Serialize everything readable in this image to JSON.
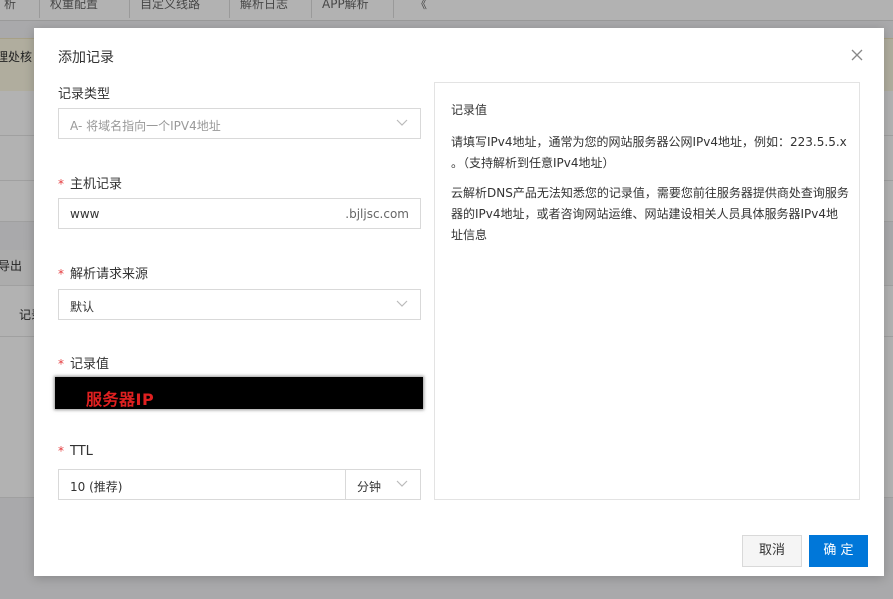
{
  "background": {
    "tabs": [
      "析",
      "权重配置",
      "自定义线路",
      "解析日志",
      "APP解析",
      "《"
    ],
    "banner_text": "理处核",
    "side_texts": [
      "导出",
      "记录"
    ]
  },
  "dialog": {
    "title": "添加记录",
    "close_icon": "close-icon",
    "fields": {
      "record_type": {
        "label": "记录类型",
        "value": "A- 将域名指向一个IPV4地址"
      },
      "host": {
        "label": "主机记录",
        "value": "www",
        "suffix": ".bjljsc.com"
      },
      "source": {
        "label": "解析请求来源",
        "value": "默认"
      },
      "record_value": {
        "label": "记录值",
        "redacted_text": "服务器IP"
      },
      "ttl": {
        "label": "TTL",
        "value": "10 (推荐)",
        "unit": "分钟"
      }
    },
    "required_mark": "*",
    "help": {
      "title": "记录值",
      "p1": "请填写IPv4地址，通常为您的网站服务器公网IPv4地址，例如：223.5.5.x 。（支持解析到任意IPv4地址）",
      "p2": "云解析DNS产品无法知悉您的记录值，需要您前往服务器提供商处查询服务器的IPv4地址，或者咨询网站运维、网站建设相关人员具体服务器IPv4地址信息"
    },
    "buttons": {
      "cancel": "取消",
      "ok": "确 定"
    }
  },
  "colors": {
    "primary": "#0077d9",
    "required": "#e4393c",
    "redact_text": "#e02020"
  }
}
